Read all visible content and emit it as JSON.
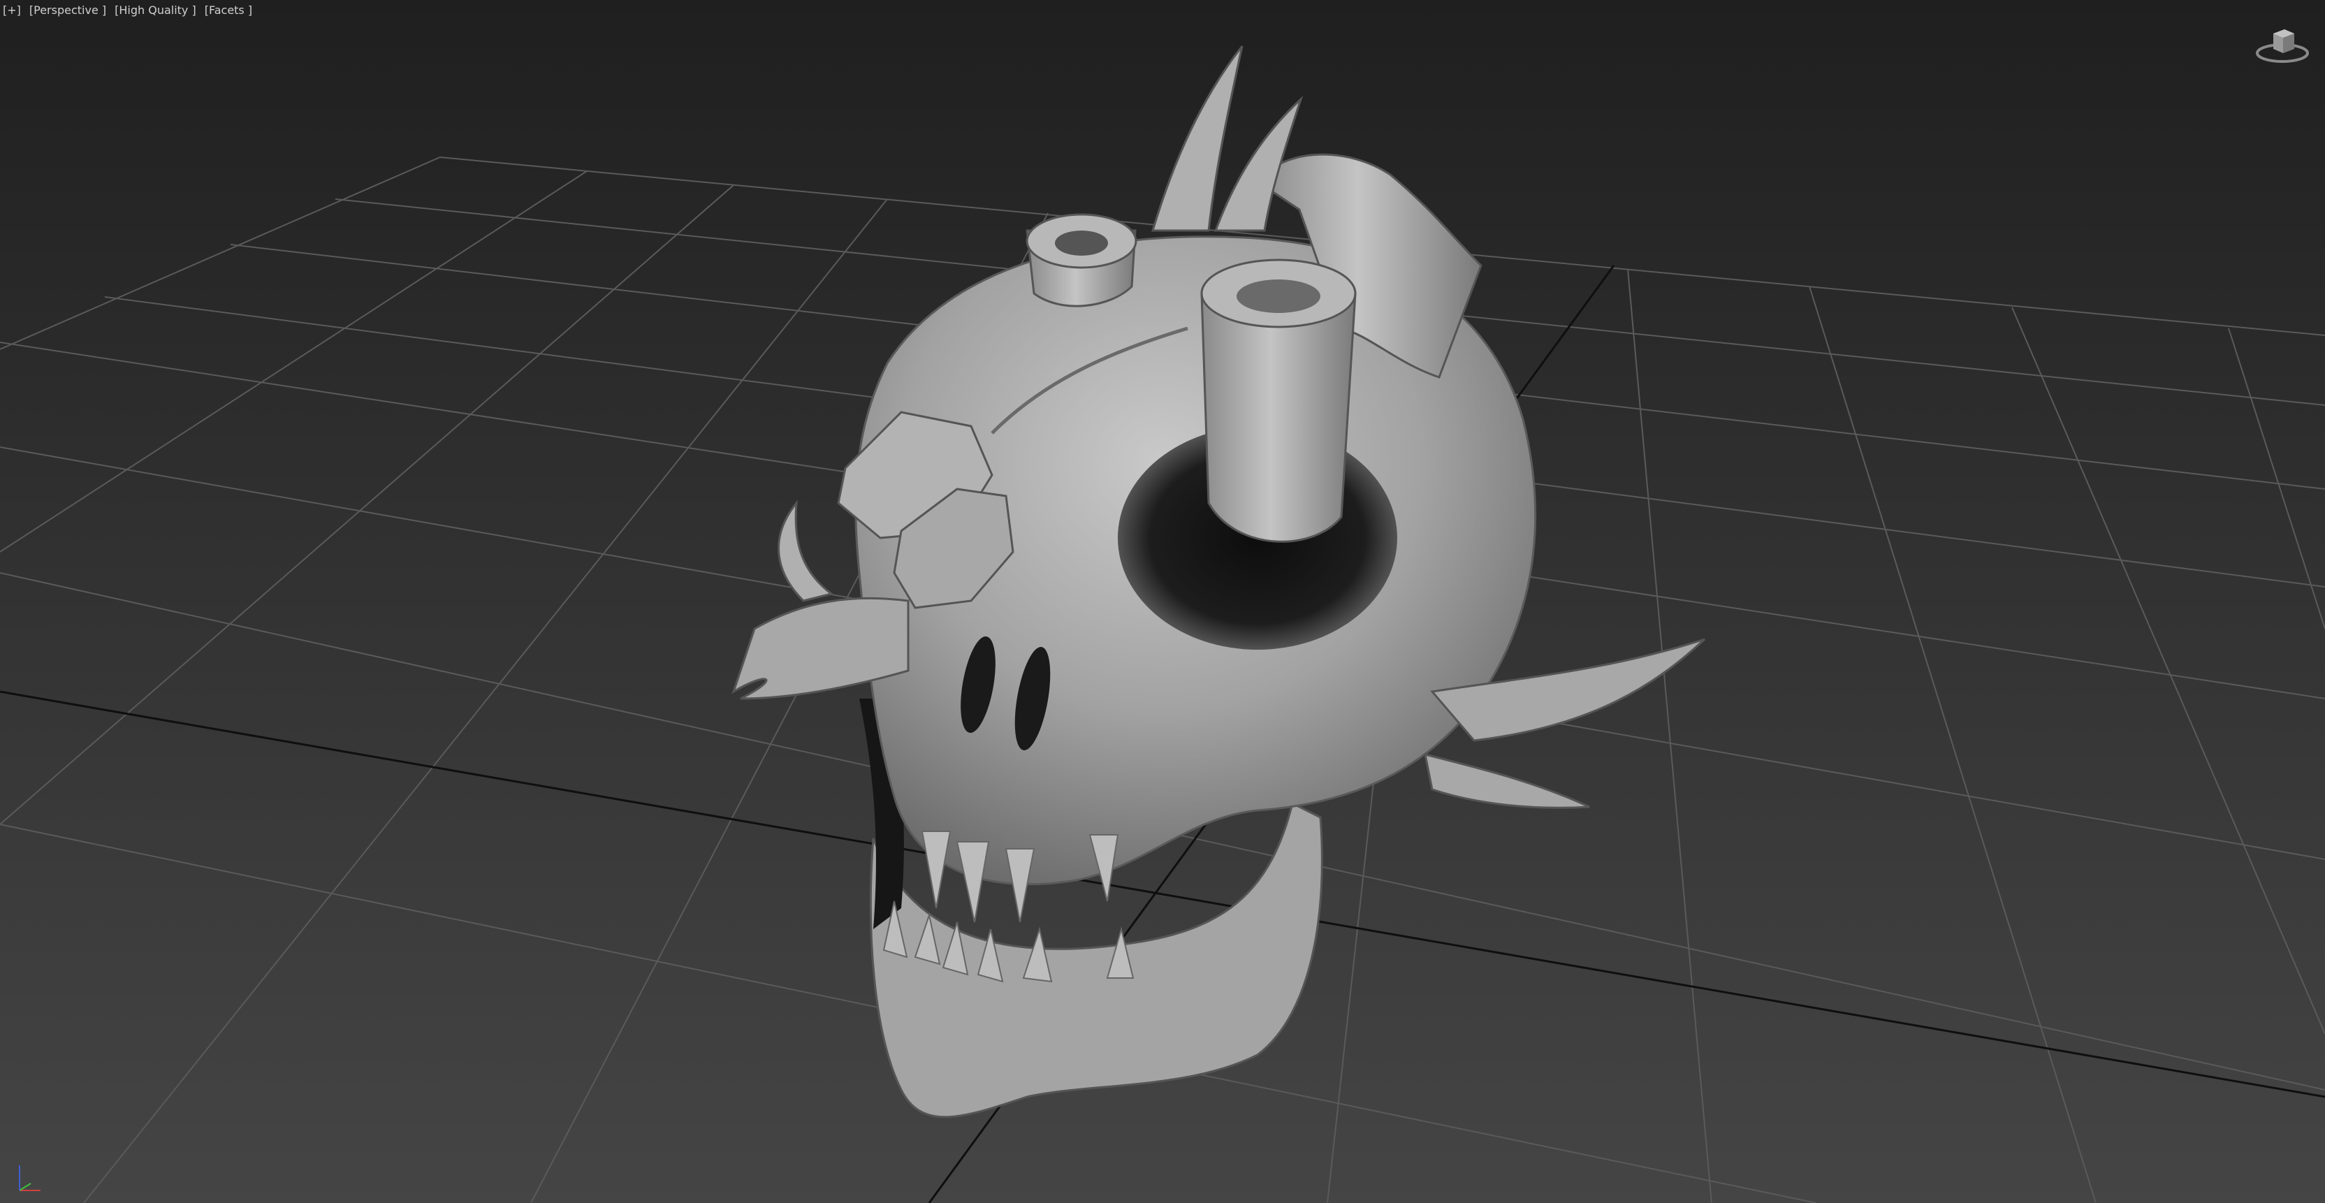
{
  "viewport": {
    "labels": [
      "[+]",
      "[Perspective ]",
      "[High Quality ]",
      "[Facets ]"
    ],
    "background_top": "#1f1f1f",
    "background_bottom": "#454545",
    "grid_color": "#5a5a5a",
    "axis_line_color": "#0f0f0f",
    "model_color": "#a9a9a9"
  },
  "viewcube": {
    "icon": "viewcube-icon"
  },
  "axis_gizmo": {
    "icon": "axis-tripod-icon",
    "x_color": "#d04040",
    "y_color": "#40c040",
    "z_color": "#4060d0"
  }
}
